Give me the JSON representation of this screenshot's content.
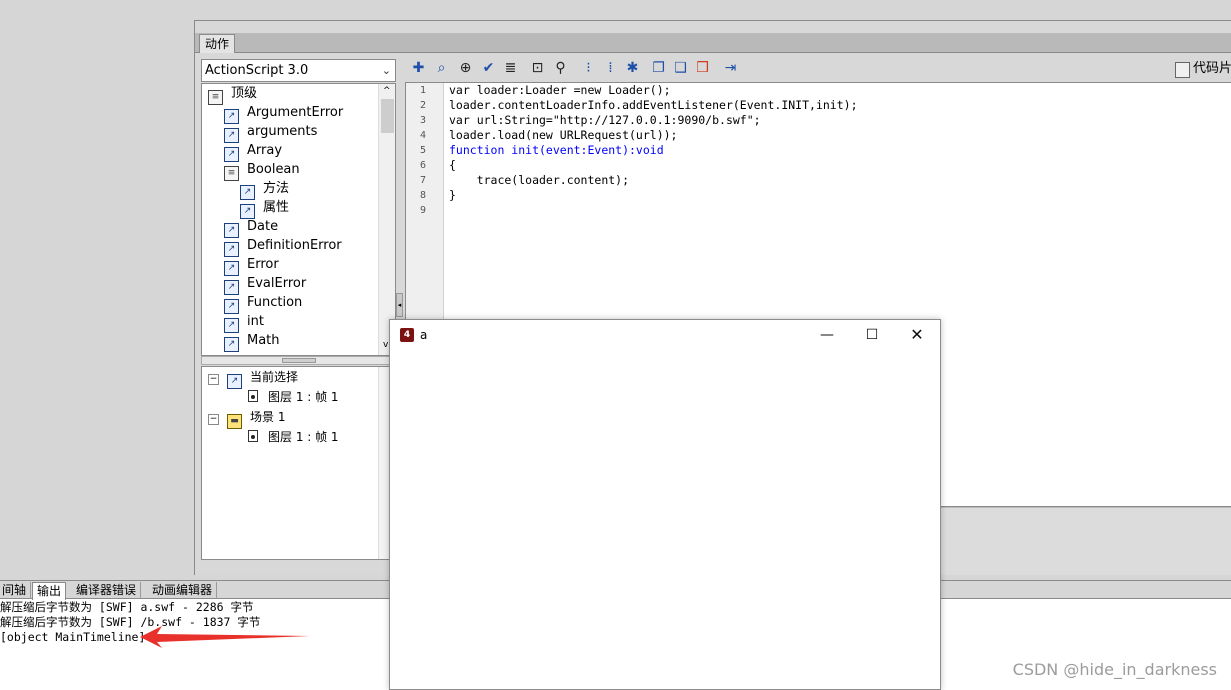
{
  "actions_panel": {
    "tab_label": "动作",
    "version_select": "ActionScript 3.0",
    "toolbox_items": [
      {
        "label": "顶级",
        "icon": "book-icon",
        "indent": 0
      },
      {
        "label": "ArgumentError",
        "icon": "class-icon",
        "indent": 1
      },
      {
        "label": "arguments",
        "icon": "class-icon",
        "indent": 1
      },
      {
        "label": "Array",
        "icon": "class-icon",
        "indent": 1
      },
      {
        "label": "Boolean",
        "icon": "book-icon",
        "indent": 1
      },
      {
        "label": "方法",
        "icon": "class-icon",
        "indent": 2
      },
      {
        "label": "属性",
        "icon": "class-icon",
        "indent": 2
      },
      {
        "label": "Date",
        "icon": "class-icon",
        "indent": 1
      },
      {
        "label": "DefinitionError",
        "icon": "class-icon",
        "indent": 1
      },
      {
        "label": "Error",
        "icon": "class-icon",
        "indent": 1
      },
      {
        "label": "EvalError",
        "icon": "class-icon",
        "indent": 1
      },
      {
        "label": "Function",
        "icon": "class-icon",
        "indent": 1
      },
      {
        "label": "int",
        "icon": "class-icon",
        "indent": 1
      },
      {
        "label": "Math",
        "icon": "class-icon",
        "indent": 1
      }
    ],
    "script_nav": {
      "current_selection": "当前选择",
      "current_frame": "图层 1 : 帧 1",
      "scene": "场景 1",
      "scene_frame": "图层 1 : 帧 1"
    },
    "code_snippets_label": "代码片",
    "toolbar_icons": [
      "add-icon",
      "find-icon",
      "target-icon",
      "check-syntax-icon",
      "auto-format-icon",
      "code-hint-icon",
      "debug-icon",
      "collapse-braces-icon",
      "collapse-selection-icon",
      "expand-all-icon",
      "comment-block-icon",
      "comment-line-icon",
      "uncomment-icon",
      "script-assist-icon"
    ],
    "code_lines": [
      {
        "n": "1",
        "text": "var loader:Loader =new Loader();"
      },
      {
        "n": "2",
        "text": "loader.contentLoaderInfo.addEventListener(Event.INIT,init);"
      },
      {
        "n": "3",
        "text": "var url:String=\"http://127.0.0.1:9090/b.swf\";"
      },
      {
        "n": "4",
        "text": "loader.load(new URLRequest(url));"
      },
      {
        "n": "5",
        "text": "function init(event:Event):void"
      },
      {
        "n": "6",
        "text": "{"
      },
      {
        "n": "7",
        "text": "    trace(loader.content);"
      },
      {
        "n": "8",
        "text": "}"
      },
      {
        "n": "9",
        "text": ""
      }
    ]
  },
  "output_panel": {
    "tabs": [
      "间轴",
      "输出",
      "编译器错误",
      "动画编辑器"
    ],
    "active_tab": "输出",
    "lines": [
      "解压缩后字节数为 [SWF] a.swf - 2286 字节",
      "解压缩后字节数为 [SWF] /b.swf - 1837 字节",
      "[object MainTimeline]"
    ],
    "arrow_color": "#e8312b"
  },
  "swf_window": {
    "title": "a",
    "app_icon": "flash-player-icon"
  },
  "watermark": "CSDN @hide_in_darkness"
}
